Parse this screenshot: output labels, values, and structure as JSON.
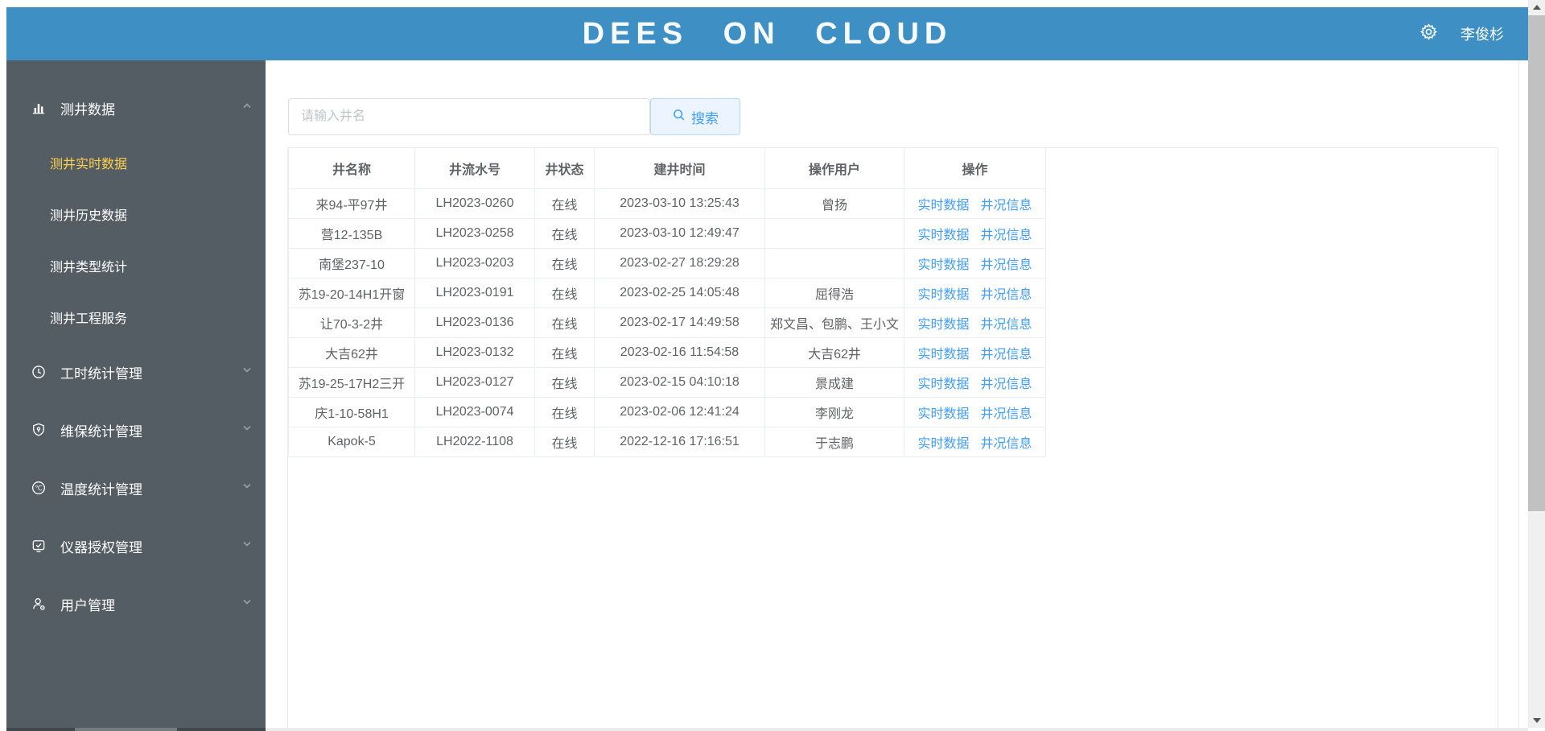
{
  "header": {
    "title": "DEES ON CLOUD",
    "user": "李俊杉"
  },
  "sidebar": {
    "groups": [
      {
        "label": "测井数据",
        "icon": "bar-chart-icon",
        "expanded": true,
        "children": [
          {
            "label": "测井实时数据",
            "active": true
          },
          {
            "label": "测井历史数据",
            "active": false
          },
          {
            "label": "测井类型统计",
            "active": false
          },
          {
            "label": "测井工程服务",
            "active": false
          }
        ]
      },
      {
        "label": "工时统计管理",
        "icon": "clock-icon",
        "expanded": false,
        "children": []
      },
      {
        "label": "维保统计管理",
        "icon": "shield-wrench-icon",
        "expanded": false,
        "children": []
      },
      {
        "label": "温度统计管理",
        "icon": "temperature-icon",
        "expanded": false,
        "children": []
      },
      {
        "label": "仪器授权管理",
        "icon": "device-auth-icon",
        "expanded": false,
        "children": []
      },
      {
        "label": "用户管理",
        "icon": "user-icon",
        "expanded": false,
        "children": []
      }
    ]
  },
  "search": {
    "placeholder": "请输入井名",
    "button_label": "搜索"
  },
  "table": {
    "columns": [
      "井名称",
      "井流水号",
      "井状态",
      "建井时间",
      "操作用户",
      "操作"
    ],
    "action_labels": [
      "实时数据",
      "井况信息"
    ],
    "rows": [
      {
        "name": "来94-平97井",
        "serial": "LH2023-0260",
        "status": "在线",
        "created": "2023-03-10 13:25:43",
        "operator": "曾扬"
      },
      {
        "name": "营12-135B",
        "serial": "LH2023-0258",
        "status": "在线",
        "created": "2023-03-10 12:49:47",
        "operator": ""
      },
      {
        "name": "南堡237-10",
        "serial": "LH2023-0203",
        "status": "在线",
        "created": "2023-02-27 18:29:28",
        "operator": ""
      },
      {
        "name": "苏19-20-14H1开窗",
        "serial": "LH2023-0191",
        "status": "在线",
        "created": "2023-02-25 14:05:48",
        "operator": "屈得浩"
      },
      {
        "name": "让70-3-2井",
        "serial": "LH2023-0136",
        "status": "在线",
        "created": "2023-02-17 14:49:58",
        "operator": "郑文昌、包鹏、王小文"
      },
      {
        "name": "大吉62井",
        "serial": "LH2023-0132",
        "status": "在线",
        "created": "2023-02-16 11:54:58",
        "operator": "大吉62井"
      },
      {
        "name": "苏19-25-17H2三开",
        "serial": "LH2023-0127",
        "status": "在线",
        "created": "2023-02-15 04:10:18",
        "operator": "景成建"
      },
      {
        "name": "庆1-10-58H1",
        "serial": "LH2023-0074",
        "status": "在线",
        "created": "2023-02-06 12:41:24",
        "operator": "李刚龙"
      },
      {
        "name": "Kapok-5",
        "serial": "LH2022-1108",
        "status": "在线",
        "created": "2022-12-16 17:16:51",
        "operator": "于志鹏"
      }
    ]
  },
  "colors": {
    "header_blue": "#3d8fc4",
    "sidebar_gray": "#545c64",
    "active_menu_yellow": "#ffd04b",
    "link_blue": "#409eff",
    "button_bg": "#ecf5ff",
    "button_border": "#b3d8ff",
    "table_border": "#ebeef5"
  }
}
